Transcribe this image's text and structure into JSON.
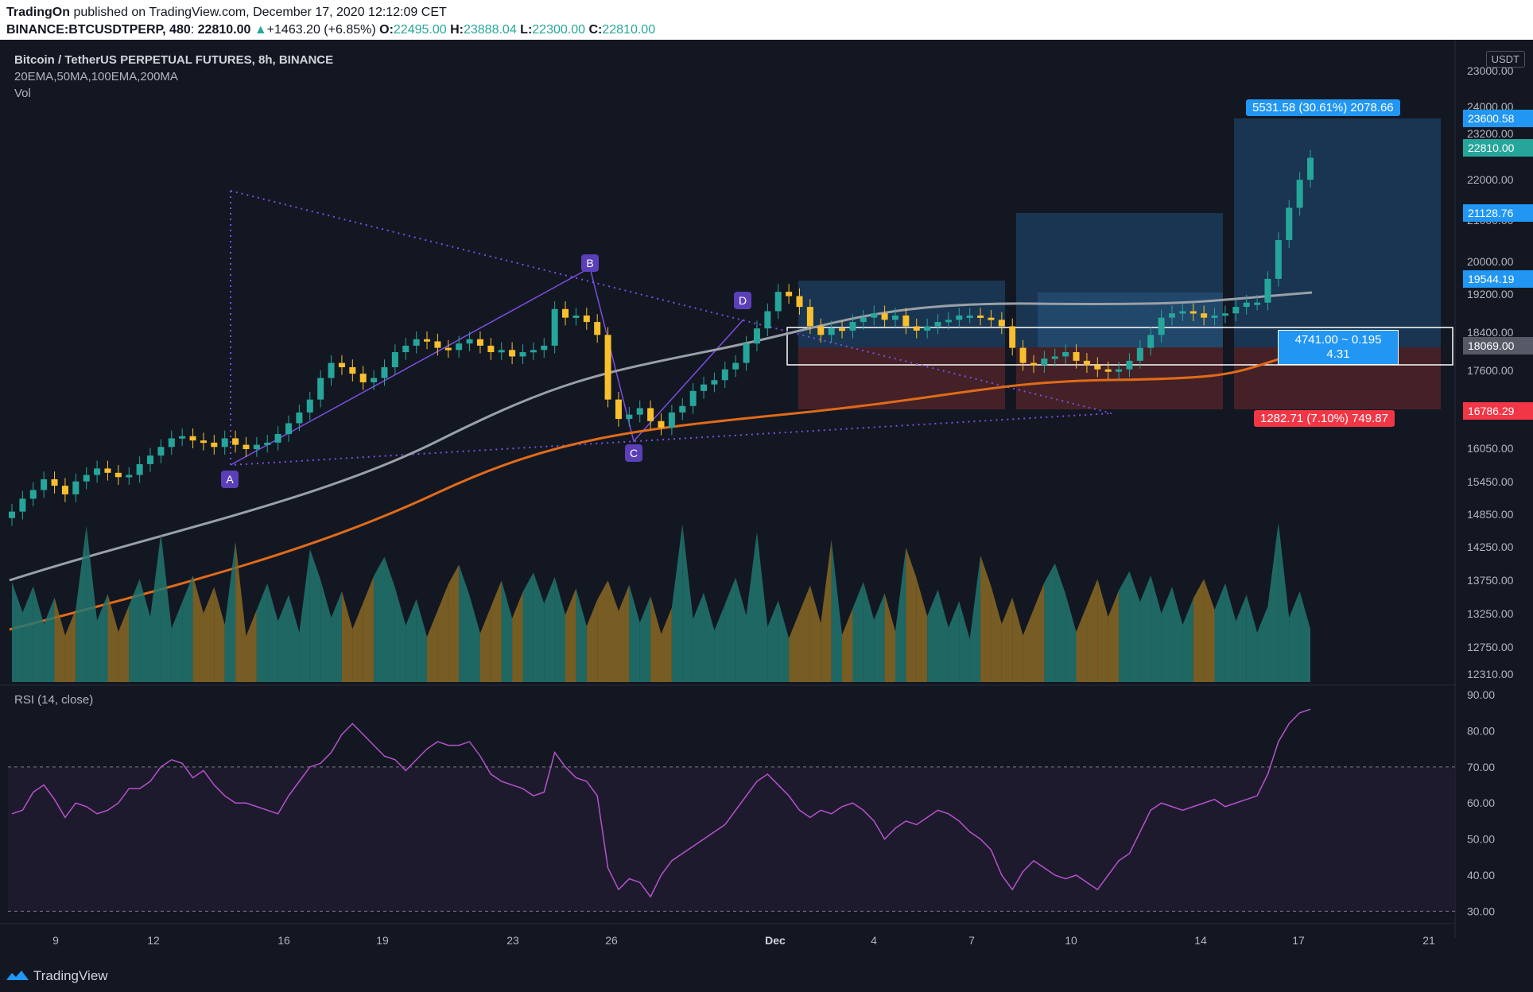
{
  "header": {
    "publisher": "TradingOn",
    "published_text": " published on TradingView.com, December 17, 2020 12:12:09 CET",
    "symbol": "BINANCE:BTCUSDTPERP, 480",
    "last": "22810.00",
    "change": "+1463.20 (+6.85%)",
    "o_label": "O:",
    "o": "22495.00",
    "h_label": "H:",
    "h": "23888.04",
    "l_label": "L:",
    "l": "22300.00",
    "c_label": "C:",
    "c": "22810.00"
  },
  "legend": {
    "title": "Bitcoin / TetherUS PERPETUAL FUTURES, 8h, BINANCE",
    "indicators": "20EMA,50MA,100EMA,200MA",
    "volume": "Vol",
    "rsi": "RSI (14, close)"
  },
  "currency": "USDT",
  "footer": {
    "brand": "TradingView"
  },
  "colors": {
    "up": "#26a69a",
    "down": "#f9c02e",
    "ma_gray": "#9aa0a8",
    "ma_orange": "#e06b1a",
    "pattern": "#7b4fe0",
    "rsi": "#b553c9",
    "target_bg": "#1c3d5e",
    "stop_bg": "#4a2227"
  },
  "chart_data": {
    "type": "candlestick",
    "timeframe": "8h",
    "price_axis": {
      "ticks": [
        "23000.00",
        "24000.00",
        "23200.00",
        "22000.00",
        "21000.00",
        "20000.00",
        "19200.00",
        "18400.00",
        "17600.00",
        "16800.00",
        "16050.00",
        "15450.00",
        "14850.00",
        "14250.00",
        "13750.00",
        "13250.00",
        "12750.00",
        "12310.00"
      ],
      "ylim": [
        12310,
        25000
      ]
    },
    "time_axis": {
      "labels": [
        "9",
        "12",
        "16",
        "19",
        "23",
        "26",
        "Dec",
        "4",
        "7",
        "10",
        "14",
        "17",
        "21"
      ]
    },
    "price_tags": [
      {
        "label": "23600.58",
        "value": 23600.58,
        "kind": "target"
      },
      {
        "label": "22810.00",
        "value": 22810.0,
        "kind": "last"
      },
      {
        "label": "21128.76",
        "value": 21128.76,
        "kind": "level"
      },
      {
        "label": "19544.19",
        "value": 19544.19,
        "kind": "level"
      },
      {
        "label": "18069.00",
        "value": 18069.0,
        "kind": "entry"
      },
      {
        "label": "16786.29",
        "value": 16786.29,
        "kind": "stop"
      }
    ],
    "position_tool": {
      "target_text": "5531.58 (30.61%) 2078.66",
      "entry_text_1": "4741.00 ~ 0.195",
      "entry_text_2": "4.31",
      "stop_text": "1282.71 (7.10%) 749.87"
    },
    "pattern_labels": [
      "A",
      "B",
      "C",
      "D"
    ],
    "candles_close": [
      14600,
      14900,
      15100,
      15350,
      15200,
      15000,
      15300,
      15450,
      15600,
      15500,
      15400,
      15450,
      15700,
      15900,
      16100,
      16300,
      16350,
      16250,
      16200,
      16100,
      16300,
      16150,
      16050,
      16150,
      16200,
      16400,
      16650,
      16900,
      17200,
      17700,
      18050,
      17950,
      17800,
      17600,
      17700,
      17950,
      18300,
      18450,
      18600,
      18550,
      18400,
      18350,
      18500,
      18600,
      18450,
      18300,
      18350,
      18200,
      18300,
      18350,
      18450,
      19300,
      19100,
      19150,
      19000,
      18700,
      17200,
      16750,
      16850,
      17000,
      16700,
      16550,
      16900,
      17050,
      17400,
      17550,
      17650,
      17900,
      18050,
      18500,
      18850,
      19250,
      19700,
      19600,
      19350,
      18900,
      18700,
      18850,
      18800,
      19000,
      19100,
      19200,
      19050,
      19150,
      18900,
      18800,
      18900,
      19000,
      19050,
      19150,
      19150,
      19100,
      19050,
      18900,
      18400,
      18050,
      18000,
      18150,
      18200,
      18300,
      18100,
      18000,
      17900,
      17850,
      17900,
      18100,
      18400,
      18700,
      19100,
      19200,
      19250,
      19200,
      19100,
      19150,
      19200,
      19350,
      19450,
      19450,
      20000,
      20900,
      21650,
      22300,
      22810
    ],
    "rsi": {
      "ylim": [
        27,
        92
      ],
      "levels": [
        30,
        70
      ],
      "ticks": [
        "90.00",
        "80.00",
        "70.00",
        "60.00",
        "50.00",
        "40.00",
        "30.00"
      ],
      "values": [
        57,
        58,
        63,
        65,
        61,
        56,
        60,
        59,
        57,
        58,
        60,
        64,
        64,
        66,
        70,
        72,
        71,
        67,
        69,
        65,
        62,
        60,
        60,
        59,
        58,
        57,
        62,
        66,
        70,
        71,
        74,
        79,
        82,
        79,
        76,
        73,
        72,
        69,
        72,
        75,
        77,
        76,
        76,
        77,
        73,
        68,
        66,
        65,
        64,
        62,
        63,
        74,
        70,
        67,
        66,
        62,
        42,
        36,
        39,
        38,
        34,
        40,
        44,
        46,
        48,
        50,
        52,
        54,
        58,
        62,
        66,
        68,
        65,
        62,
        58,
        56,
        58,
        57,
        59,
        60,
        58,
        55,
        50,
        53,
        55,
        54,
        56,
        58,
        57,
        55,
        52,
        50,
        47,
        40,
        36,
        41,
        44,
        42,
        40,
        39,
        40,
        38,
        36,
        40,
        44,
        46,
        52,
        58,
        60,
        59,
        58,
        59,
        60,
        61,
        59,
        60,
        61,
        62,
        68,
        77,
        82,
        85,
        86
      ]
    }
  }
}
